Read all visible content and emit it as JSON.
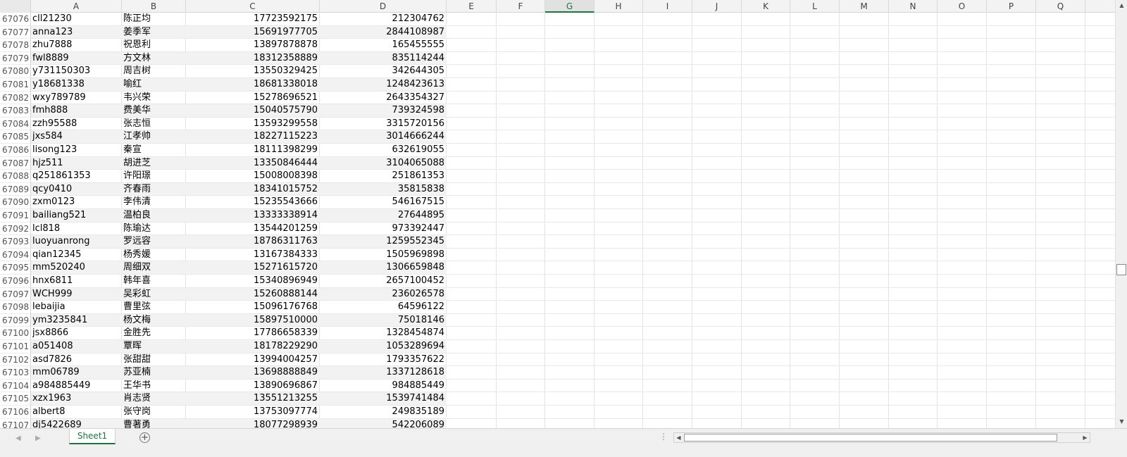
{
  "sheet": {
    "columns": [
      "A",
      "B",
      "C",
      "D",
      "E",
      "F",
      "G",
      "H",
      "I",
      "J",
      "K",
      "L",
      "M",
      "N",
      "O",
      "P",
      "Q"
    ],
    "selected_column": "G",
    "rows": [
      {
        "row": "67076",
        "a": "cll21230",
        "b": "陈正均",
        "c": "17723592175",
        "d": "212304762"
      },
      {
        "row": "67077",
        "a": "anna123",
        "b": "姜季军",
        "c": "15691977705",
        "d": "2844108987"
      },
      {
        "row": "67078",
        "a": "zhu7888",
        "b": "祝恩利",
        "c": "13897878878",
        "d": "165455555"
      },
      {
        "row": "67079",
        "a": "fwl8889",
        "b": "方文林",
        "c": "18312358889",
        "d": "835114244"
      },
      {
        "row": "67080",
        "a": "y731150303",
        "b": "周吉树",
        "c": "13550329425",
        "d": "342644305"
      },
      {
        "row": "67081",
        "a": "y18681338",
        "b": "喻红",
        "c": "18681338018",
        "d": "1248423613"
      },
      {
        "row": "67082",
        "a": "wxy789789",
        "b": "韦兴荣",
        "c": "15278696521",
        "d": "2643354327"
      },
      {
        "row": "67083",
        "a": "fmh888",
        "b": "费美华",
        "c": "15040575790",
        "d": "739324598"
      },
      {
        "row": "67084",
        "a": "zzh95588",
        "b": "张志恒",
        "c": "13593299558",
        "d": "3315720156"
      },
      {
        "row": "67085",
        "a": "jxs584",
        "b": "江孝帅",
        "c": "18227115223",
        "d": "3014666244"
      },
      {
        "row": "67086",
        "a": "lisong123",
        "b": "秦宣",
        "c": "18111398299",
        "d": "632619055"
      },
      {
        "row": "67087",
        "a": "hjz511",
        "b": "胡进芝",
        "c": "13350846444",
        "d": "3104065088"
      },
      {
        "row": "67088",
        "a": "q251861353",
        "b": "许阳璟",
        "c": "15008008398",
        "d": "251861353"
      },
      {
        "row": "67089",
        "a": "qcy0410",
        "b": "齐春雨",
        "c": "18341015752",
        "d": "35815838"
      },
      {
        "row": "67090",
        "a": "zxm0123",
        "b": "李伟清",
        "c": "15235543666",
        "d": "546167515"
      },
      {
        "row": "67091",
        "a": "bailiang521",
        "b": "温柏良",
        "c": "13333338914",
        "d": "27644895"
      },
      {
        "row": "67092",
        "a": "lcl818",
        "b": "陈瑜达",
        "c": "13544201259",
        "d": "973392447"
      },
      {
        "row": "67093",
        "a": "luoyuanrong",
        "b": "罗远容",
        "c": "18786311763",
        "d": "1259552345"
      },
      {
        "row": "67094",
        "a": "qian12345",
        "b": "杨秀媛",
        "c": "13167384333",
        "d": "1505969898"
      },
      {
        "row": "67095",
        "a": "mm520240",
        "b": "周细双",
        "c": "15271615720",
        "d": "1306659848"
      },
      {
        "row": "67096",
        "a": "hnx6811",
        "b": "韩年喜",
        "c": "15340896949",
        "d": "2657100452"
      },
      {
        "row": "67097",
        "a": "WCH999",
        "b": "吴彩虹",
        "c": "15260888144",
        "d": "236026578"
      },
      {
        "row": "67098",
        "a": "lebaijia",
        "b": "曹里弦",
        "c": "15096176768",
        "d": "64596122"
      },
      {
        "row": "67099",
        "a": "ym3235841",
        "b": "杨文梅",
        "c": "15897510000",
        "d": "75018146"
      },
      {
        "row": "67100",
        "a": "jsx8866",
        "b": "金胜先",
        "c": "17786658339",
        "d": "1328454874"
      },
      {
        "row": "67101",
        "a": "a051408",
        "b": "覃晖",
        "c": "18178229290",
        "d": "1053289694"
      },
      {
        "row": "67102",
        "a": "asd7826",
        "b": "张甜甜",
        "c": "13994004257",
        "d": "1793357622"
      },
      {
        "row": "67103",
        "a": "mm06789",
        "b": "苏亚楠",
        "c": "13698888849",
        "d": "1337128618"
      },
      {
        "row": "67104",
        "a": "a984885449",
        "b": "王华书",
        "c": "13890696867",
        "d": "984885449"
      },
      {
        "row": "67105",
        "a": "xzx1963",
        "b": "肖志贤",
        "c": "13551213255",
        "d": "1539741484"
      },
      {
        "row": "67106",
        "a": "albert8",
        "b": "张守岗",
        "c": "13753097774",
        "d": "249835189"
      },
      {
        "row": "67107",
        "a": "dj5422689",
        "b": "曹著勇",
        "c": "18077298939",
        "d": "542206089"
      }
    ]
  },
  "bottom": {
    "sheet_tab": "Sheet1",
    "add_sheet": "⊕",
    "options_dots": "⋮"
  },
  "icons": {
    "nav_prev": "◀",
    "nav_next": "▶",
    "scroll_up": "▲",
    "scroll_down": "▼",
    "scroll_left": "◀",
    "scroll_right": "▶"
  },
  "colors": {
    "accent": "#217346",
    "header_bg": "#f3f3f3",
    "stripe": "#f2f2f2"
  }
}
